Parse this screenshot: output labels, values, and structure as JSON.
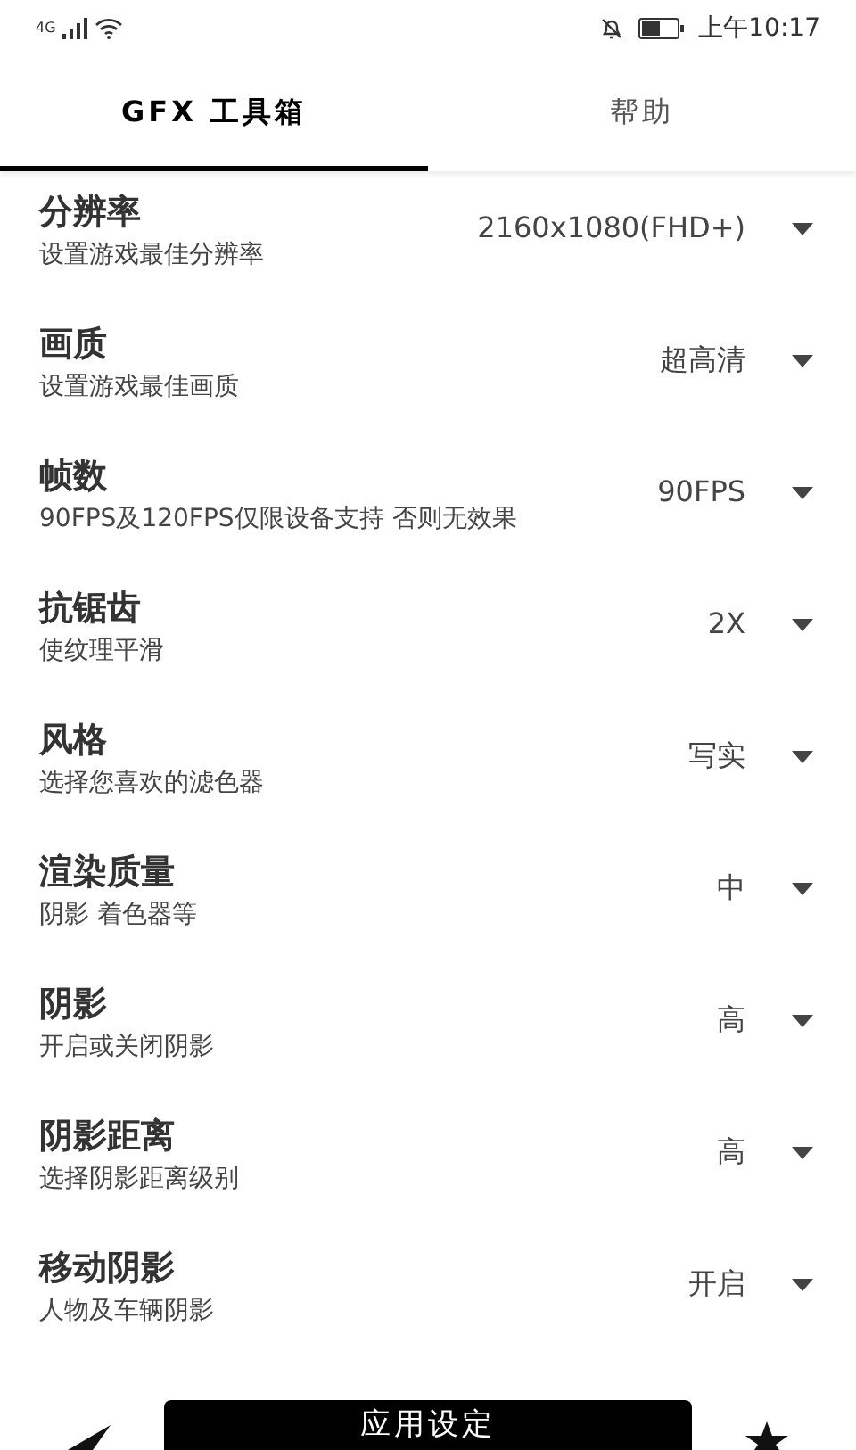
{
  "status_bar": {
    "network": "4G",
    "time": "上午10:17"
  },
  "tabs": [
    {
      "label": "GFX 工具箱",
      "selected": true
    },
    {
      "label": "帮助",
      "selected": false
    }
  ],
  "settings": [
    {
      "title": "分辨率",
      "subtitle": "设置游戏最佳分辨率",
      "value": "2160x1080(FHD+)"
    },
    {
      "title": "画质",
      "subtitle": "设置游戏最佳画质",
      "value": "超高清"
    },
    {
      "title": "帧数",
      "subtitle": "90FPS及120FPS仅限设备支持 否则无效果",
      "value": "90FPS"
    },
    {
      "title": "抗锯齿",
      "subtitle": "使纹理平滑",
      "value": "2X"
    },
    {
      "title": "风格",
      "subtitle": "选择您喜欢的滤色器",
      "value": "写实"
    },
    {
      "title": "渲染质量",
      "subtitle": "阴影 着色器等",
      "value": "中"
    },
    {
      "title": "阴影",
      "subtitle": "开启或关闭阴影",
      "value": "高"
    },
    {
      "title": "阴影距离",
      "subtitle": "选择阴影距离级别",
      "value": "高"
    },
    {
      "title": "移动阴影",
      "subtitle": "人物及车辆阴影",
      "value": "开启"
    }
  ],
  "apply_button": "应用设定"
}
